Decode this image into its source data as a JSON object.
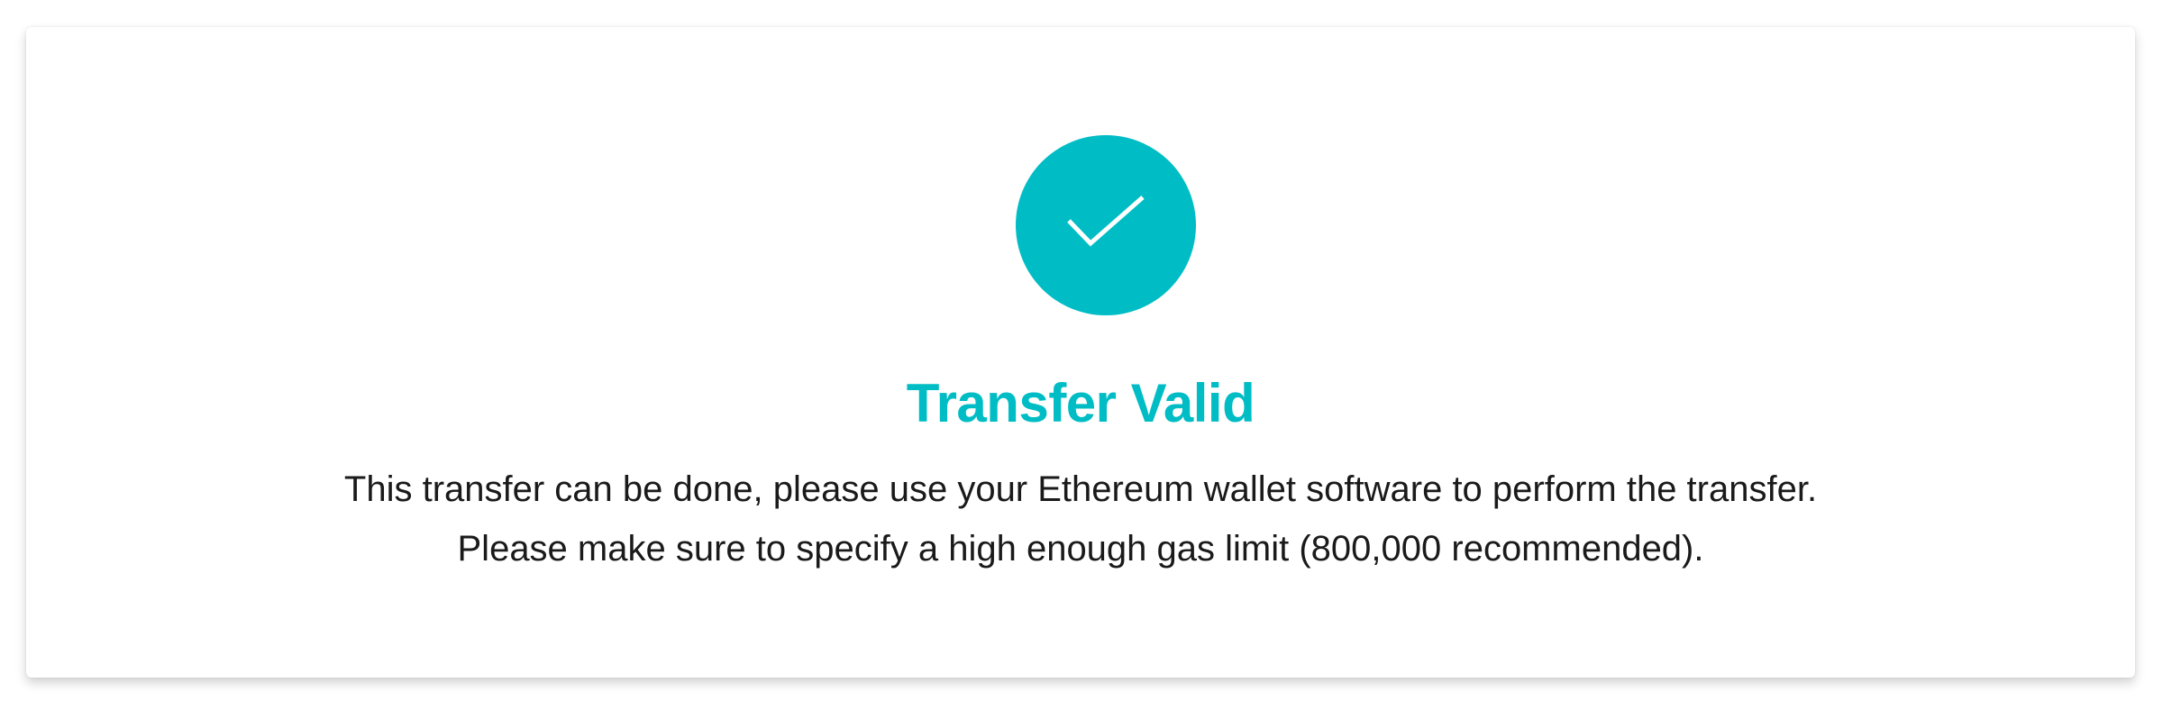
{
  "status_card": {
    "icon": "checkmark-icon",
    "accent_color": "#00bdc5",
    "title": "Transfer Valid",
    "message_line_1": "This transfer can be done, please use your Ethereum wallet software to perform the transfer.",
    "message_line_2": "Please make sure to specify a high enough gas limit (800,000 recommended)."
  }
}
